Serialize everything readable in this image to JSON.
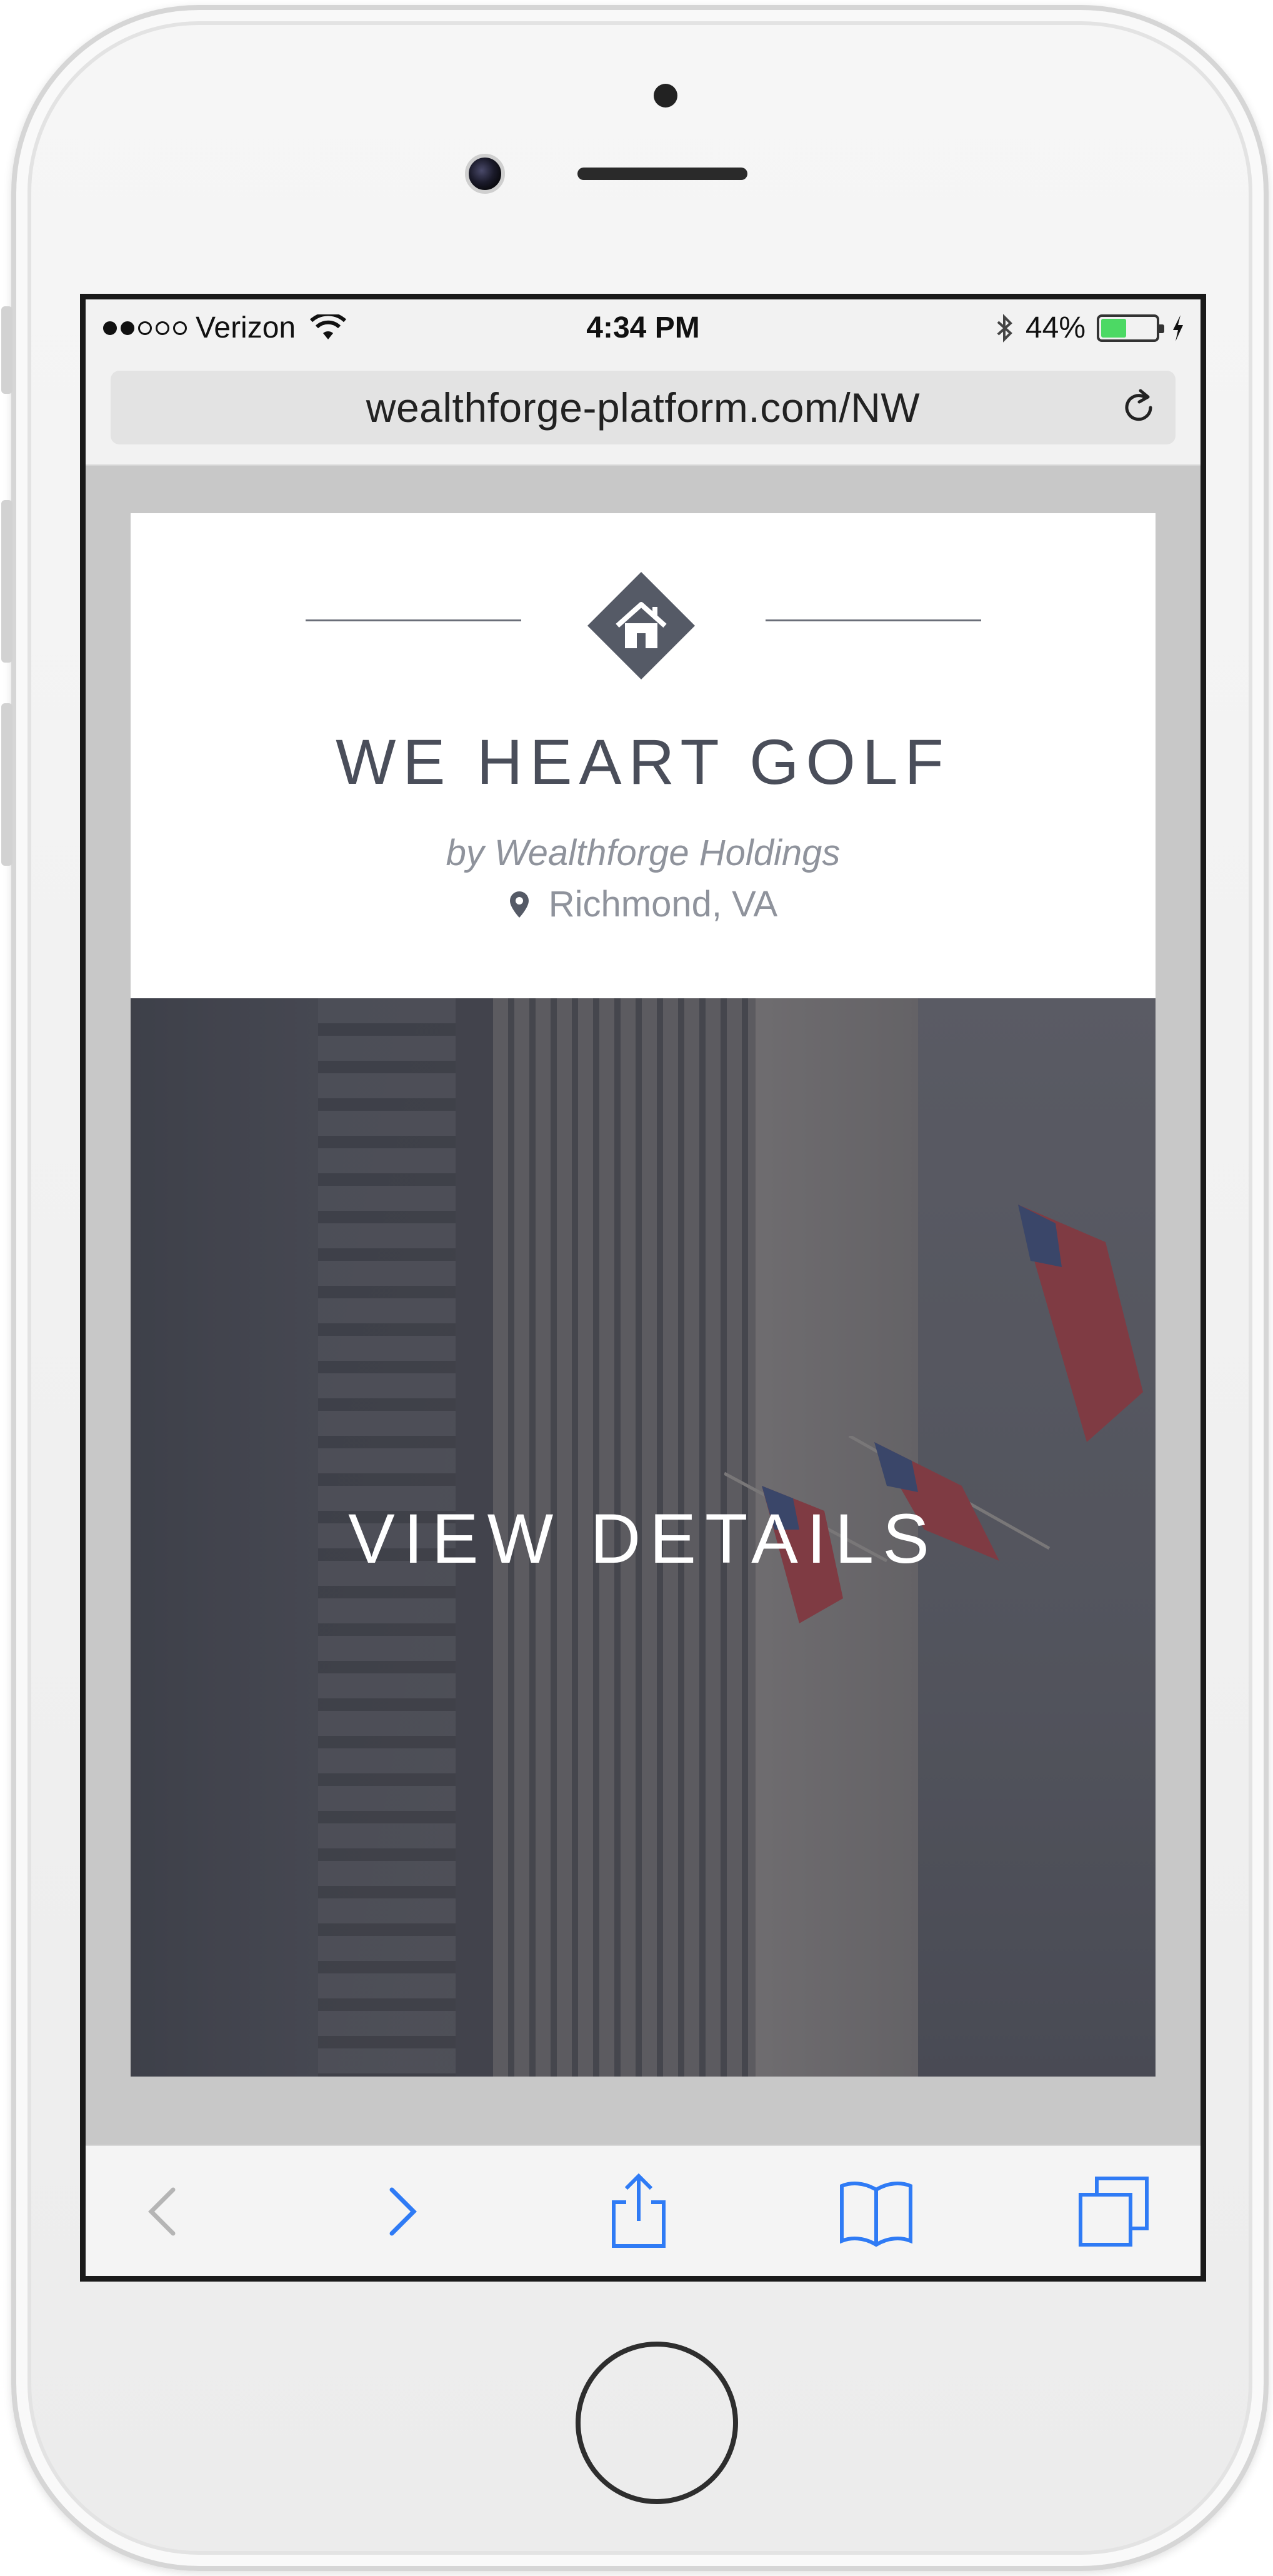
{
  "status_bar": {
    "carrier": "Verizon",
    "time": "4:34 PM",
    "battery": "44%",
    "battery_level": 0.44
  },
  "browser": {
    "url": "wealthforge-platform.com/NW"
  },
  "listing": {
    "title": "WE HEART GOLF",
    "byline": "by Wealthforge Holdings",
    "location": "Richmond, VA",
    "cta": "VIEW DETAILS"
  },
  "icons": {
    "logo": "house-icon",
    "location": "map-pin-icon",
    "reload": "reload-icon",
    "back": "back-chevron-icon",
    "forward": "forward-chevron-icon",
    "share": "share-icon",
    "bookmarks": "bookmarks-icon",
    "tabs": "tabs-icon"
  },
  "colors": {
    "brand": "#4a4e5a",
    "muted_text": "#8f939c",
    "ios_blue": "#2f7bf5",
    "battery_green": "#4cd964"
  }
}
